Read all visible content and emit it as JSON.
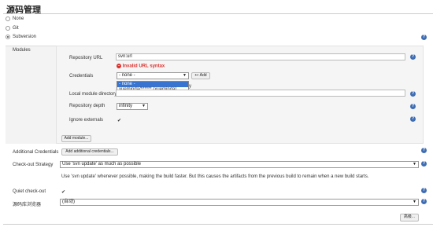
{
  "page": {
    "title": "源码管理"
  },
  "scm_options": [
    {
      "label": "None"
    },
    {
      "label": "Git"
    },
    {
      "label": "Subversion"
    }
  ],
  "modules": {
    "section_label": "Modules",
    "repository_url_label": "Repository URL",
    "repository_url_value": "svn:url",
    "error_text": "Invalid URL syntax",
    "credentials_label": "Credentials",
    "credentials_selected": "- none -",
    "add_button": "Add",
    "credential_options": [
      "- none -",
      "xueminda/****** (xueminda)"
    ],
    "local_dir_label": "Local module directory",
    "local_dir_suffix": "y",
    "depth_label": "Repository depth",
    "depth_value": "infinity",
    "ignore_externals_label": "Ignore externals",
    "ignore_externals_checked": "✔",
    "add_module_button": "Add module..."
  },
  "additional_credentials": {
    "label": "Additional Credentials",
    "button": "Add additional credentials..."
  },
  "checkout_strategy": {
    "label": "Check-out Strategy",
    "selected": "Use 'svn update' as much as possible",
    "description": "Use 'svn update' whenever possible, making the build faster. But this causes the artifacts from the previous build to remain when a new build starts."
  },
  "quiet_checkout": {
    "label": "Quiet check-out",
    "checked": "✔"
  },
  "repo_browser": {
    "label": "源码库浏览器",
    "selected": "(自动)"
  },
  "advanced_button": "高级...",
  "icons": {
    "help": "help-icon",
    "error": "error-icon",
    "dropdown": "chevron-down-icon",
    "key": "key-icon"
  },
  "colors": {
    "help": "#3f6db3",
    "error": "#d9302c",
    "selection": "#3874d0"
  }
}
